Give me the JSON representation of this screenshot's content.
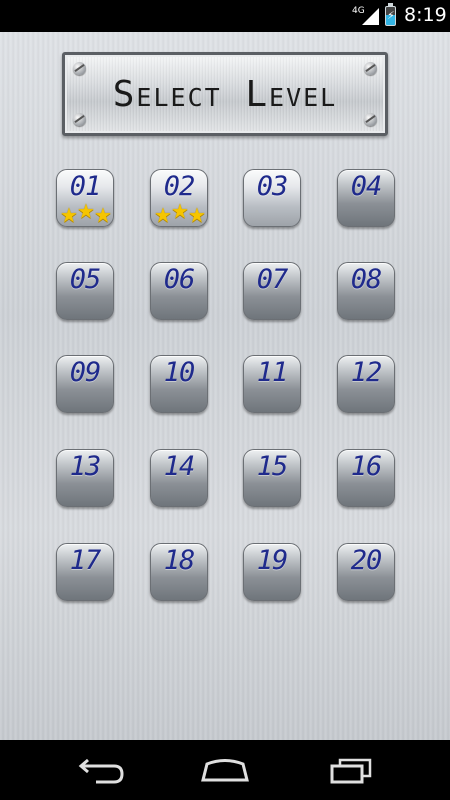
{
  "status_bar": {
    "network": "4G",
    "time": "8:19",
    "battery_level": 0.55
  },
  "title": "Select Level",
  "levels": [
    {
      "label": "01",
      "stars": 3,
      "unlocked": true
    },
    {
      "label": "02",
      "stars": 3,
      "unlocked": true
    },
    {
      "label": "03",
      "stars": 0,
      "unlocked": true
    },
    {
      "label": "04",
      "stars": 0,
      "unlocked": false
    },
    {
      "label": "05",
      "stars": 0,
      "unlocked": false
    },
    {
      "label": "06",
      "stars": 0,
      "unlocked": false
    },
    {
      "label": "07",
      "stars": 0,
      "unlocked": false
    },
    {
      "label": "08",
      "stars": 0,
      "unlocked": false
    },
    {
      "label": "09",
      "stars": 0,
      "unlocked": false
    },
    {
      "label": "10",
      "stars": 0,
      "unlocked": false
    },
    {
      "label": "11",
      "stars": 0,
      "unlocked": false
    },
    {
      "label": "12",
      "stars": 0,
      "unlocked": false
    },
    {
      "label": "13",
      "stars": 0,
      "unlocked": false
    },
    {
      "label": "14",
      "stars": 0,
      "unlocked": false
    },
    {
      "label": "15",
      "stars": 0,
      "unlocked": false
    },
    {
      "label": "16",
      "stars": 0,
      "unlocked": false
    },
    {
      "label": "17",
      "stars": 0,
      "unlocked": false
    },
    {
      "label": "18",
      "stars": 0,
      "unlocked": false
    },
    {
      "label": "19",
      "stars": 0,
      "unlocked": false
    },
    {
      "label": "20",
      "stars": 0,
      "unlocked": false
    }
  ],
  "colors": {
    "level_number": "#1f2a8c",
    "star": "#f6c500",
    "battery_fill": "#33b5e5"
  },
  "icons": {
    "signal": "signal-icon",
    "battery": "battery-charging-icon",
    "back": "back-icon",
    "home": "home-icon",
    "recents": "recents-icon",
    "star": "star-icon",
    "screw": "screw-icon"
  }
}
